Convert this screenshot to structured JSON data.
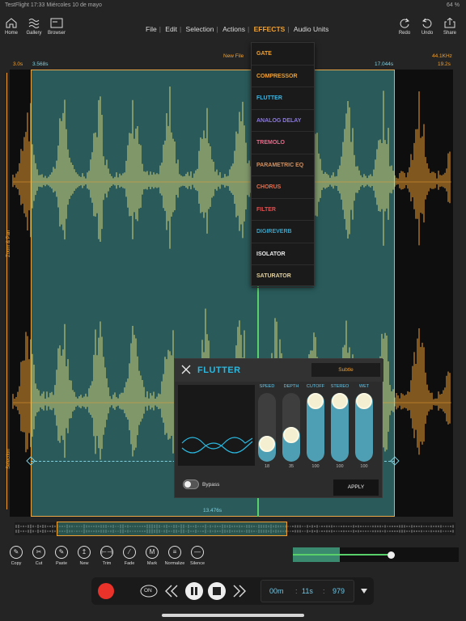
{
  "status": {
    "left": "TestFlight  17:33  Miércoles 10 de mayo",
    "right": "64 %"
  },
  "toolbar": {
    "home": "Home",
    "gallery": "Gallery",
    "browser": "Browser",
    "redo": "Redo",
    "undo": "Undo",
    "share": "Share"
  },
  "menu": {
    "file": "File",
    "edit": "Edit",
    "selection": "Selection",
    "actions": "Actions",
    "effects": "EFFECTS",
    "audio_units": "Audio Units"
  },
  "ruler": {
    "start": "3.0s",
    "sel_start": "3.568s",
    "file_name": "New File",
    "sel_end": "17.044s",
    "end": "19.2s",
    "sample_rate": "44.1KHz",
    "sel_length": "13.476s"
  },
  "side_labels": {
    "zoom_pan": "Zoom & Pan",
    "selection": "Selection"
  },
  "effects_menu": [
    {
      "label": "GATE",
      "color": "#f0a030"
    },
    {
      "label": "COMPRESSOR",
      "color": "#f0a030"
    },
    {
      "label": "FLUTTER",
      "color": "#3ab8e8"
    },
    {
      "label": "ANALOG DELAY",
      "color": "#8c7ad8"
    },
    {
      "label": "TREMOLO",
      "color": "#e86a8a"
    },
    {
      "label": "PARAMETRIC EQ",
      "color": "#d09060"
    },
    {
      "label": "CHORUS",
      "color": "#e07050"
    },
    {
      "label": "FILTER",
      "color": "#e05050"
    },
    {
      "label": "DIGIREVERB",
      "color": "#40a0c0"
    },
    {
      "label": "ISOLATOR",
      "color": "#eeeeee"
    },
    {
      "label": "SATURATOR",
      "color": "#e0d0a0"
    }
  ],
  "flutter": {
    "title": "FLUTTER",
    "preset": "Subtle",
    "bypass_label": "Bypass",
    "apply_label": "APPLY",
    "sliders": [
      {
        "label": "SPEED",
        "value": "18",
        "level": 0.18
      },
      {
        "label": "DEPTH",
        "value": "35",
        "level": 0.35
      },
      {
        "label": "CUTOFF",
        "value": "100",
        "level": 1.0
      },
      {
        "label": "STEREO",
        "value": "100",
        "level": 1.0
      },
      {
        "label": "WET",
        "value": "100",
        "level": 1.0
      }
    ]
  },
  "tools": [
    {
      "label": "Copy",
      "glyph": "✎"
    },
    {
      "label": "Cut",
      "glyph": "✂"
    },
    {
      "label": "Paste",
      "glyph": "✎"
    },
    {
      "label": "New",
      "glyph": "↥"
    },
    {
      "label": "Trim",
      "glyph": "⊢⊣"
    },
    {
      "label": "Fade",
      "glyph": "⁄"
    },
    {
      "label": "Mark",
      "glyph": "M"
    },
    {
      "label": "Normalize",
      "glyph": "≡"
    },
    {
      "label": "Silence",
      "glyph": "—"
    }
  ],
  "transport": {
    "loop_label": "ON",
    "minutes": "00m",
    "seconds": "11s",
    "millis": "979"
  },
  "zoom_level": 0.6,
  "colors": {
    "accent": "#f0a030",
    "wave_selected": "#d6d47a",
    "wave_unselected": "#f0a030",
    "selection_bg": "#2a5a5a",
    "playhead": "#5ad06a",
    "record": "#e8322a"
  }
}
